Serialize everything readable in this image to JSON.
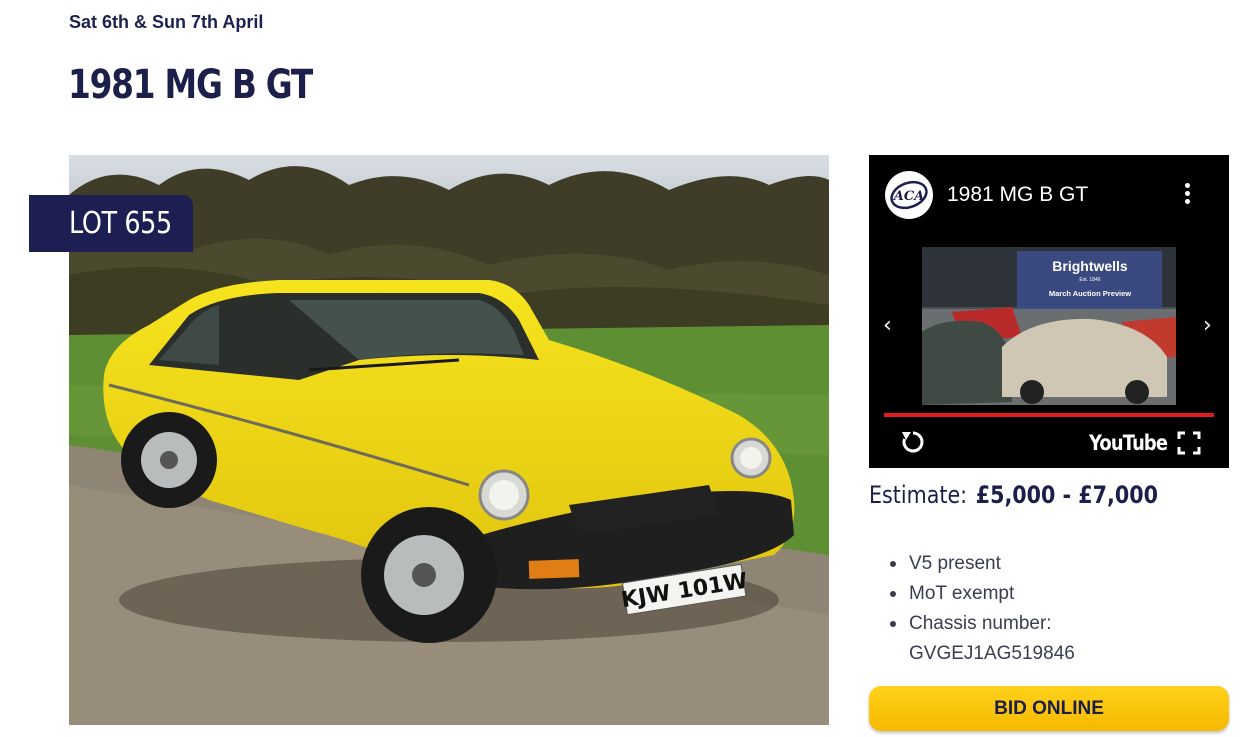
{
  "event": {
    "dates": "Sat 6th & Sun 7th April"
  },
  "lot": {
    "title": "1981 MG B GT",
    "badge": "LOT 655",
    "plate": "KJW 101W"
  },
  "video": {
    "channel_icon": "aca-logo",
    "title": "1981 MG B GT",
    "thumbnail": {
      "brand": "Brightwells",
      "est": "Est. 1846",
      "caption": "March Auction Preview"
    },
    "platform": "YouTube",
    "progress": 1.0,
    "icons": [
      "menu-dots-icon",
      "prev-arrow-icon",
      "next-arrow-icon",
      "replay-icon",
      "fullscreen-icon"
    ]
  },
  "estimate": {
    "label": "Estimate:",
    "value": "£5,000 - £7,000"
  },
  "details": [
    "V5 present",
    "MoT exempt",
    "Chassis number: GVGEJ1AG519846"
  ],
  "actions": {
    "bid_label": "BID ONLINE"
  },
  "colors": {
    "navy": "#1d1f52",
    "bid_yellow": "#f9c400",
    "progress_red": "#e21b1b",
    "car_yellow": "#f2dc1a"
  }
}
